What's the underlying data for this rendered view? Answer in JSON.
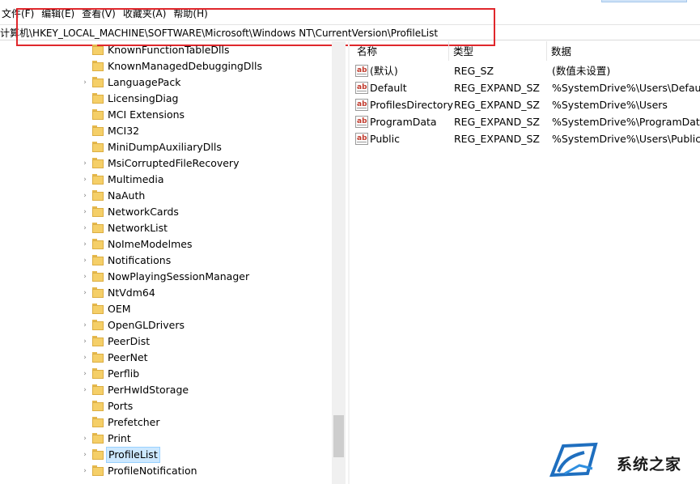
{
  "menubar": {
    "items": [
      {
        "label": "文件(F)"
      },
      {
        "label": "编辑(E)"
      },
      {
        "label": "查看(V)"
      },
      {
        "label": "收藏夹(A)"
      },
      {
        "label": "帮助(H)"
      }
    ]
  },
  "address": {
    "path": "计算机\\HKEY_LOCAL_MACHINE\\SOFTWARE\\Microsoft\\Windows NT\\CurrentVersion\\ProfileList"
  },
  "tree": {
    "items": [
      {
        "label": "KnownFunctionTableDlls",
        "expandable": false
      },
      {
        "label": "KnownManagedDebuggingDlls",
        "expandable": false
      },
      {
        "label": "LanguagePack",
        "expandable": true
      },
      {
        "label": "LicensingDiag",
        "expandable": false
      },
      {
        "label": "MCI Extensions",
        "expandable": false
      },
      {
        "label": "MCI32",
        "expandable": false
      },
      {
        "label": "MiniDumpAuxiliaryDlls",
        "expandable": false
      },
      {
        "label": "MsiCorruptedFileRecovery",
        "expandable": true
      },
      {
        "label": "Multimedia",
        "expandable": true
      },
      {
        "label": "NaAuth",
        "expandable": true
      },
      {
        "label": "NetworkCards",
        "expandable": true
      },
      {
        "label": "NetworkList",
        "expandable": true
      },
      {
        "label": "NoImeModelmes",
        "expandable": true
      },
      {
        "label": "Notifications",
        "expandable": true
      },
      {
        "label": "NowPlayingSessionManager",
        "expandable": true
      },
      {
        "label": "NtVdm64",
        "expandable": true
      },
      {
        "label": "OEM",
        "expandable": false
      },
      {
        "label": "OpenGLDrivers",
        "expandable": true
      },
      {
        "label": "PeerDist",
        "expandable": true
      },
      {
        "label": "PeerNet",
        "expandable": true
      },
      {
        "label": "Perflib",
        "expandable": true
      },
      {
        "label": "PerHwIdStorage",
        "expandable": true
      },
      {
        "label": "Ports",
        "expandable": false
      },
      {
        "label": "Prefetcher",
        "expandable": false
      },
      {
        "label": "Print",
        "expandable": true
      },
      {
        "label": "ProfileList",
        "expandable": true,
        "selected": true
      },
      {
        "label": "ProfileNotification",
        "expandable": true
      }
    ]
  },
  "list": {
    "headers": {
      "name": "名称",
      "type": "类型",
      "data": "数据"
    },
    "rows": [
      {
        "name": "(默认)",
        "type": "REG_SZ",
        "data": "(数值未设置)"
      },
      {
        "name": "Default",
        "type": "REG_EXPAND_SZ",
        "data": "%SystemDrive%\\Users\\Default"
      },
      {
        "name": "ProfilesDirectory",
        "type": "REG_EXPAND_SZ",
        "data": "%SystemDrive%\\Users"
      },
      {
        "name": "ProgramData",
        "type": "REG_EXPAND_SZ",
        "data": "%SystemDrive%\\ProgramData"
      },
      {
        "name": "Public",
        "type": "REG_EXPAND_SZ",
        "data": "%SystemDrive%\\Users\\Public"
      }
    ],
    "value_icon": "string-value-icon"
  },
  "watermark": {
    "text": "系统之家"
  },
  "colors": {
    "highlight_border": "#e0272c",
    "selection_bg": "#cce8ff",
    "folder": "#f5cf68"
  }
}
